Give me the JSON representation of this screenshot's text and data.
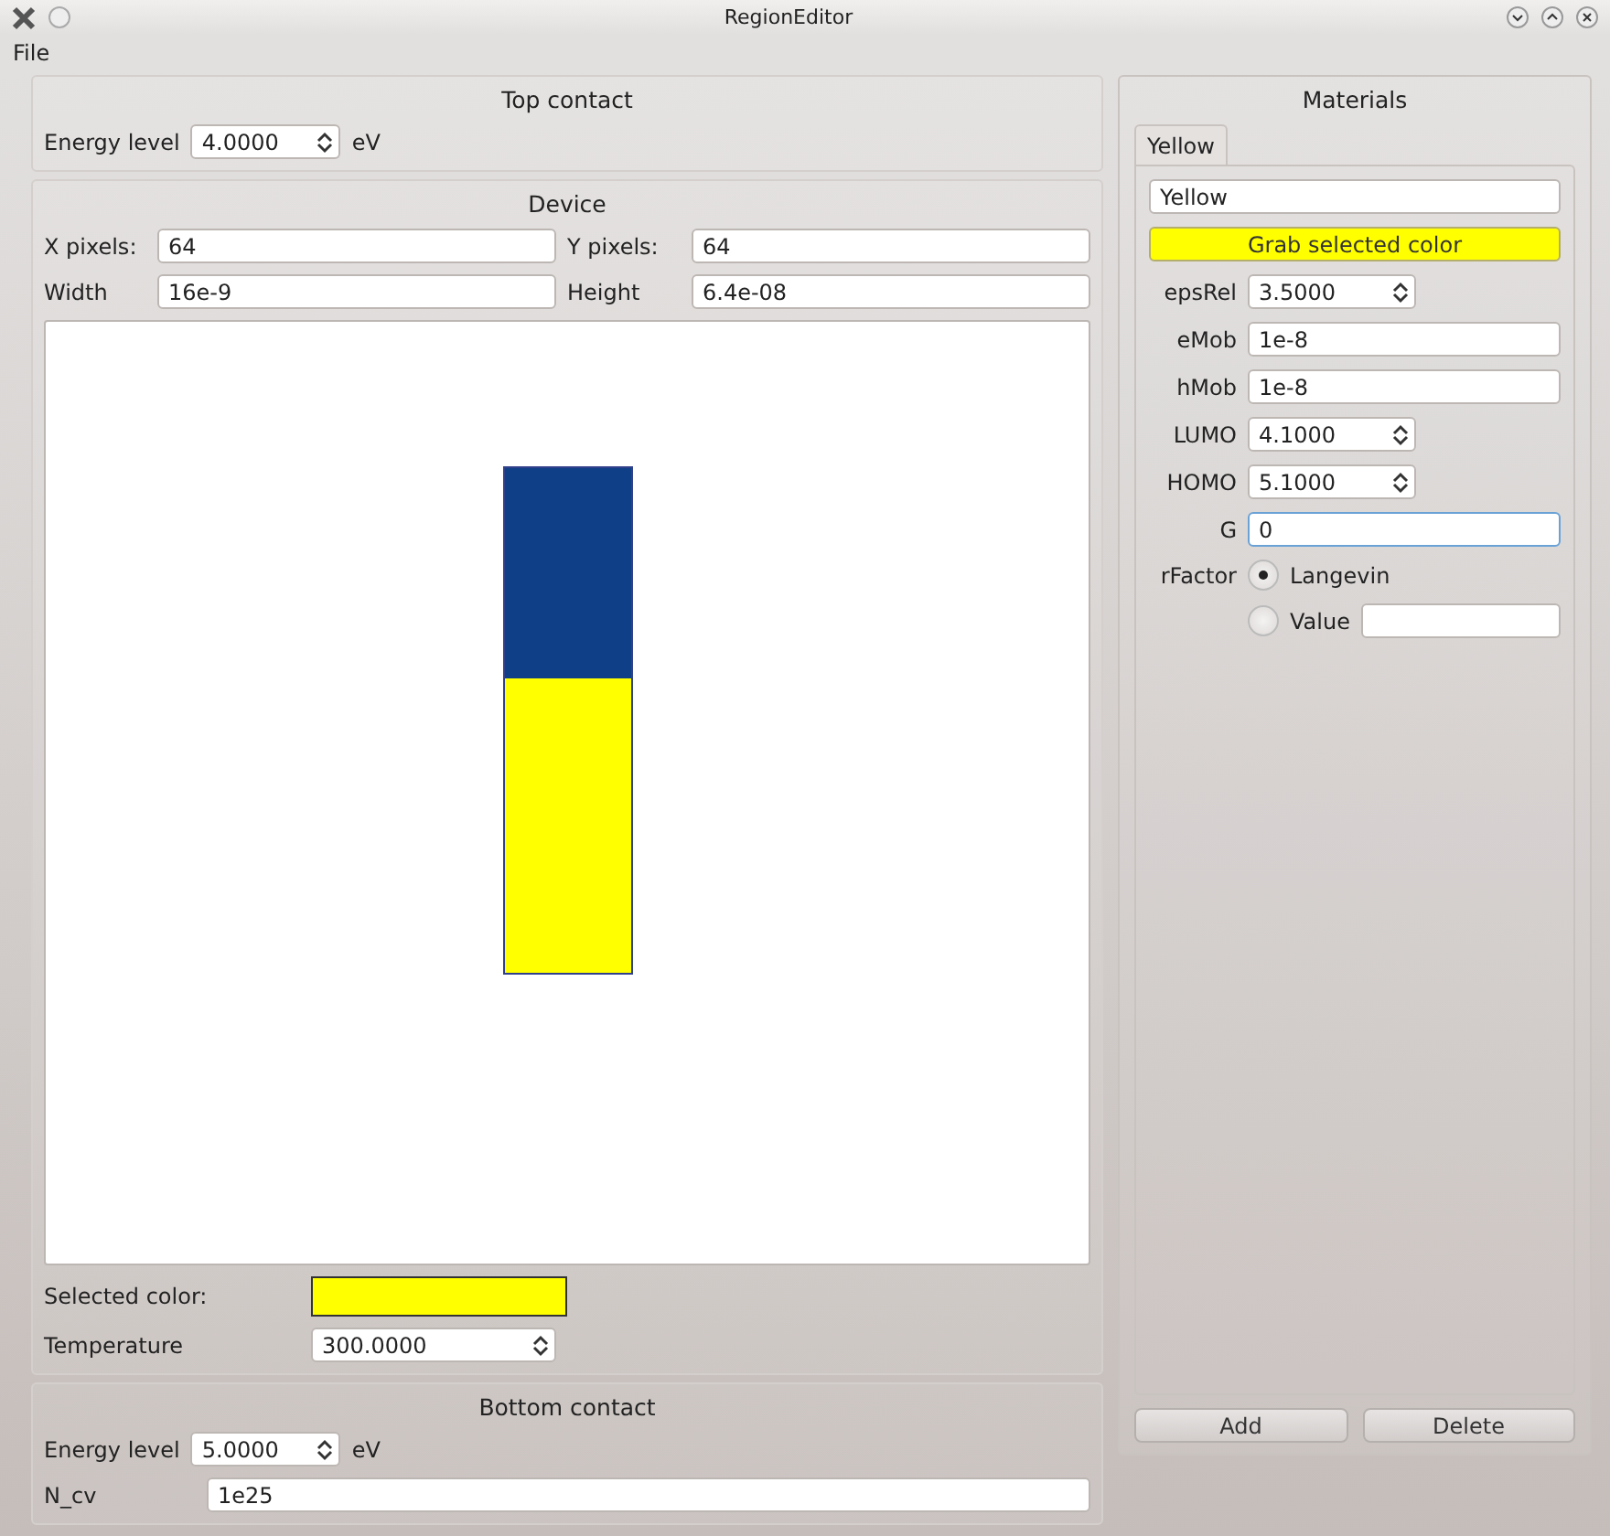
{
  "window": {
    "title": "RegionEditor"
  },
  "menu": [
    "File"
  ],
  "top_contact": {
    "title": "Top contact",
    "energy_label": "Energy level",
    "energy_value": "4.0000",
    "unit": "eV"
  },
  "device": {
    "title": "Device",
    "x_label": "X pixels:",
    "x_value": "64",
    "y_label": "Y pixels:",
    "y_value": "64",
    "width_label": "Width",
    "width_value": "16e-9",
    "height_label": "Height",
    "height_value": "6.4e-08",
    "regions": [
      {
        "color": "#0f3f86"
      },
      {
        "color": "#ffff00"
      }
    ],
    "selected_color_label": "Selected color:",
    "temperature_label": "Temperature",
    "temperature_value": "300.0000"
  },
  "bottom_contact": {
    "title": "Bottom contact",
    "energy_label": "Energy level",
    "energy_value": "5.0000",
    "unit": "eV",
    "ncv_label": "N_cv",
    "ncv_value": "1e25"
  },
  "materials": {
    "title": "Materials",
    "tabs": [
      {
        "label": "Yellow",
        "selected": true
      }
    ],
    "name_value": "Yellow",
    "grab_button": "Grab selected color",
    "fields": [
      {
        "kind": "spin",
        "label": "epsRel",
        "value": "3.5000",
        "focused": false
      },
      {
        "kind": "text",
        "label": "eMob",
        "value": "1e-8",
        "focused": false
      },
      {
        "kind": "text",
        "label": "hMob",
        "value": "1e-8",
        "focused": false
      },
      {
        "kind": "spin",
        "label": "LUMO",
        "value": "4.1000",
        "focused": false
      },
      {
        "kind": "spin",
        "label": "HOMO",
        "value": "5.1000",
        "focused": false
      },
      {
        "kind": "text",
        "label": "G",
        "value": "0",
        "focused": true
      }
    ],
    "rfactor_label": "rFactor",
    "rfactor_options": [
      {
        "label": "Langevin",
        "selected": true,
        "has_field": false
      },
      {
        "label": "Value",
        "selected": false,
        "has_field": true
      }
    ],
    "buttons": [
      "Add",
      "Delete"
    ]
  }
}
